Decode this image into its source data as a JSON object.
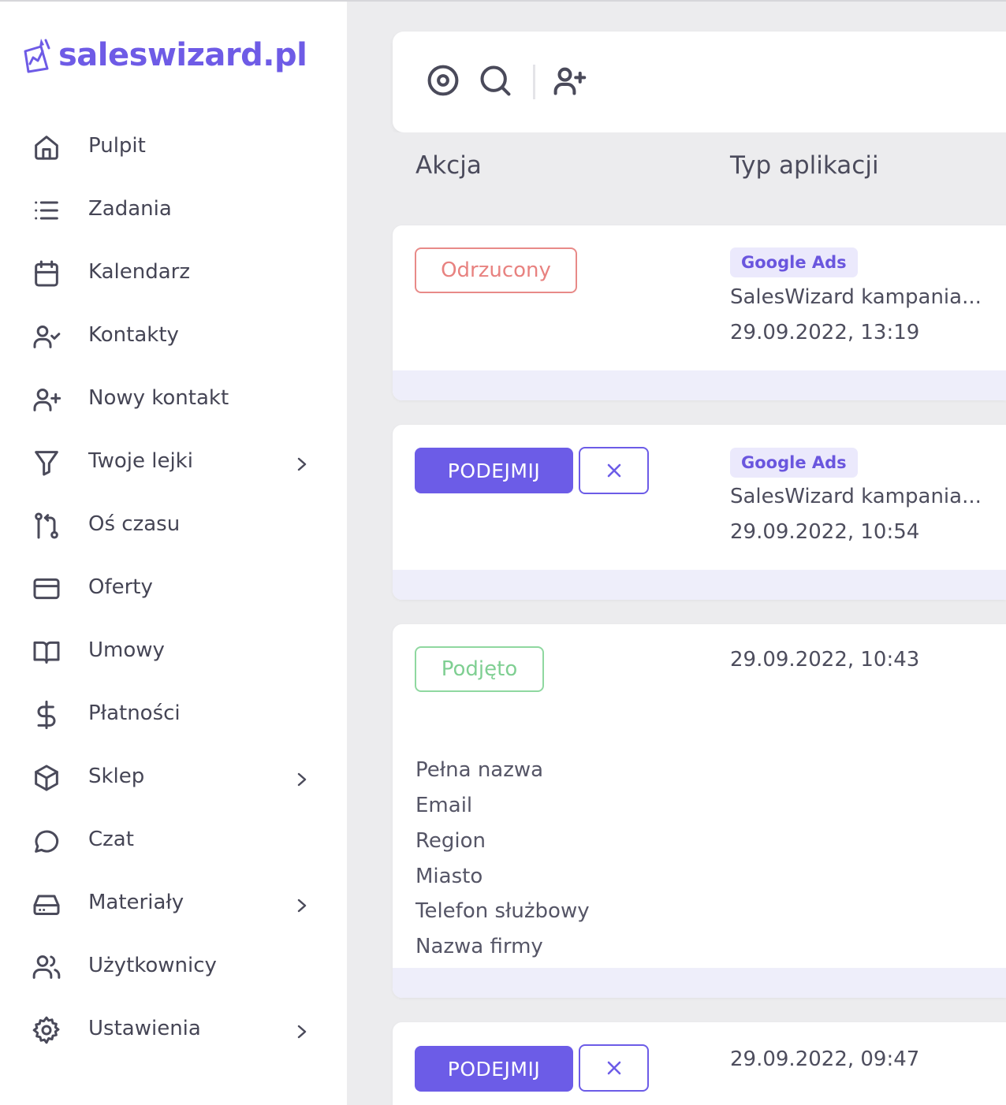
{
  "brand": {
    "name": "saleswizard.pl",
    "color": "#6e5be6"
  },
  "sidebar": {
    "items": [
      {
        "label": "Pulpit",
        "icon": "home-icon",
        "has_submenu": false
      },
      {
        "label": "Zadania",
        "icon": "list-icon",
        "has_submenu": false
      },
      {
        "label": "Kalendarz",
        "icon": "calendar-icon",
        "has_submenu": false
      },
      {
        "label": "Kontakty",
        "icon": "user-check-icon",
        "has_submenu": false
      },
      {
        "label": "Nowy kontakt",
        "icon": "user-plus-icon",
        "has_submenu": false
      },
      {
        "label": "Twoje lejki",
        "icon": "funnel-icon",
        "has_submenu": true
      },
      {
        "label": "Oś czasu",
        "icon": "git-branch-icon",
        "has_submenu": false
      },
      {
        "label": "Oferty",
        "icon": "credit-card-icon",
        "has_submenu": false
      },
      {
        "label": "Umowy",
        "icon": "book-icon",
        "has_submenu": false
      },
      {
        "label": "Płatności",
        "icon": "dollar-icon",
        "has_submenu": false
      },
      {
        "label": "Sklep",
        "icon": "box-icon",
        "has_submenu": true
      },
      {
        "label": "Czat",
        "icon": "chat-icon",
        "has_submenu": false
      },
      {
        "label": "Materiały",
        "icon": "hard-drive-icon",
        "has_submenu": true
      },
      {
        "label": "Użytkownicy",
        "icon": "users-icon",
        "has_submenu": false
      },
      {
        "label": "Ustawienia",
        "icon": "gear-icon",
        "has_submenu": true
      }
    ]
  },
  "toolbar": {
    "icons": [
      "target-icon",
      "search-icon",
      "user-plus-icon"
    ]
  },
  "table": {
    "columns": [
      "Akcja",
      "Typ aplikacji"
    ]
  },
  "rows": [
    {
      "status": "Odrzucony",
      "tag": "Google Ads",
      "campaign": "SalesWizard kampania...",
      "date": "29.09.2022, 13:19"
    },
    {
      "action_label": "PODEJMIJ",
      "tag": "Google Ads",
      "campaign": "SalesWizard kampania...",
      "date": "29.09.2022, 10:54"
    },
    {
      "status": "Podjęto",
      "date": "29.09.2022, 10:43",
      "fields": [
        "Pełna nazwa",
        "Email",
        "Region",
        "Miasto",
        "Telefon służbowy",
        "Nazwa firmy"
      ]
    },
    {
      "action_label": "PODEJMIJ",
      "date": "29.09.2022, 09:47"
    }
  ],
  "colors": {
    "primary": "#6c5ce7",
    "rejected": "#e88280",
    "accepted": "#7fcf92",
    "tag_bg": "#ebe9fc",
    "card_footer": "#eeeefa"
  }
}
